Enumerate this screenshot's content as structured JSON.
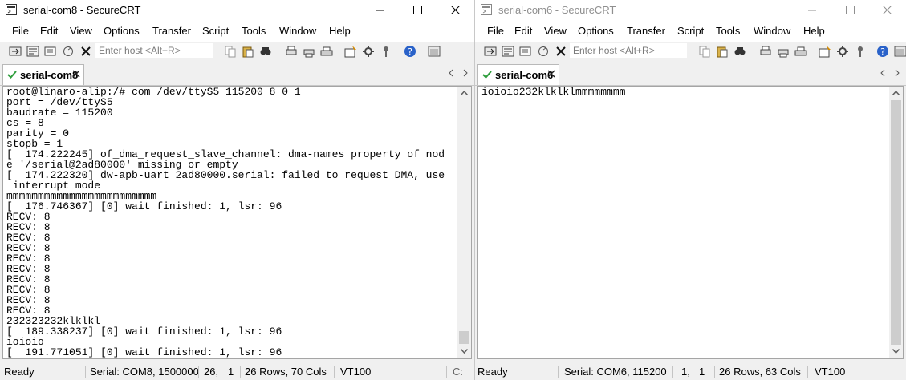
{
  "colors": {
    "terminal_bg": "#ffffff",
    "chrome_bg": "#f0f0f0",
    "inactive_title": "#8f8f8f",
    "tab_check": "#2f9e3d"
  },
  "window_left": {
    "title": "serial-com8 - SecureCRT",
    "menu": [
      "File",
      "Edit",
      "View",
      "Options",
      "Transfer",
      "Script",
      "Tools",
      "Window",
      "Help"
    ],
    "quick_connect": {
      "placeholder": "Enter host <Alt+R>",
      "value": ""
    },
    "tab": {
      "label": "serial-com8",
      "icon": "green-check-icon"
    },
    "terminal_lines": [
      "root@linaro-alip:/# com /dev/ttyS5 115200 8 0 1",
      "port = /dev/ttyS5",
      "baudrate = 115200",
      "cs = 8",
      "parity = 0",
      "stopb = 1",
      "[  174.222245] of_dma_request_slave_channel: dma-names property of nod",
      "e '/serial@2ad80000' missing or empty",
      "[  174.222320] dw-apb-uart 2ad80000.serial: failed to request DMA, use",
      " interrupt mode",
      "mmmmmmmmmmmmmmmmmmmmmmmm",
      "[  176.746367] [0] wait finished: 1, lsr: 96",
      "RECV: 8",
      "RECV: 8",
      "RECV: 8",
      "RECV: 8",
      "RECV: 8",
      "RECV: 8",
      "RECV: 8",
      "RECV: 8",
      "RECV: 8",
      "RECV: 8",
      "232323232klklkl",
      "[  189.338237] [0] wait finished: 1, lsr: 96",
      "ioioio",
      "[  191.771051] [0] wait finished: 1, lsr: 96"
    ],
    "status": {
      "ready": "Ready",
      "connection": "Serial: COM8, 1500000",
      "row": "26,",
      "col": "1",
      "size": "26 Rows, 70 Cols",
      "emulation": "VT100",
      "extra": "C:"
    }
  },
  "window_right": {
    "title": "serial-com6 - SecureCRT",
    "menu": [
      "File",
      "Edit",
      "View",
      "Options",
      "Transfer",
      "Script",
      "Tools",
      "Window",
      "Help"
    ],
    "quick_connect": {
      "placeholder": "Enter host <Alt+R>",
      "value": ""
    },
    "tab": {
      "label": "serial-com6",
      "icon": "green-check-icon"
    },
    "terminal_lines": [
      "ioioio232klklklmmmmmmmm"
    ],
    "status": {
      "ready": "Ready",
      "connection": "Serial: COM6, 115200",
      "row": "1,",
      "col": "1",
      "size": "26 Rows, 63 Cols",
      "emulation": "VT100"
    }
  }
}
